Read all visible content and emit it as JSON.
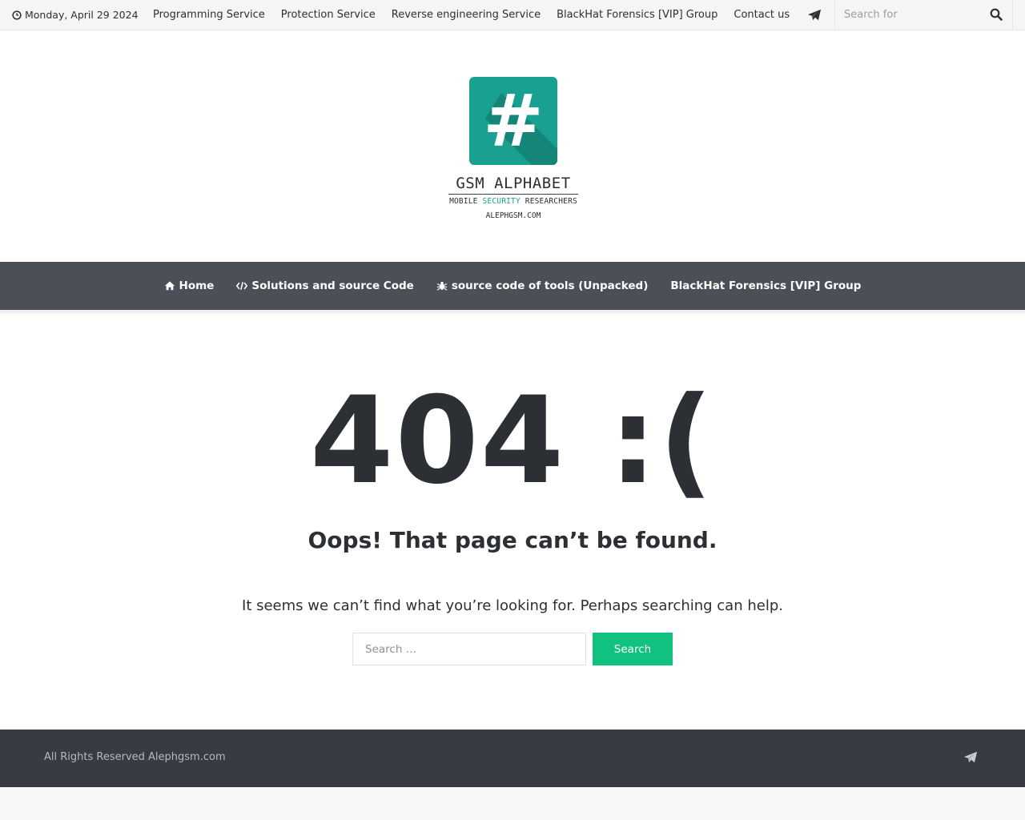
{
  "topbar": {
    "date": "Monday, April 29 2024",
    "nav": [
      {
        "label": "Programming Service"
      },
      {
        "label": "Protection Service"
      },
      {
        "label": "Reverse engineering Service"
      },
      {
        "label": "BlackHat Forensics [VIP] Group"
      },
      {
        "label": "Contact us"
      }
    ],
    "search_placeholder": "Search for",
    "icons": {
      "clock": "clock-icon",
      "telegram": "telegram-icon",
      "search": "search-icon"
    }
  },
  "logo": {
    "symbol": "#",
    "brand": "GSM ALPHABET",
    "tagline_pre": "MOBILE ",
    "tagline_highlight": "SECURITY",
    "tagline_post": " RESEARCHERS",
    "site": "ALEPHGSM.COM",
    "colors": {
      "tile": "#1aa090"
    }
  },
  "mainnav": {
    "items": [
      {
        "label": "Home",
        "icon": "home-icon"
      },
      {
        "label": "Solutions and source Code",
        "icon": "code-icon"
      },
      {
        "label": "source code of tools (Unpacked)",
        "icon": "bug-icon"
      },
      {
        "label": "BlackHat Forensics [VIP] Group",
        "icon": ""
      }
    ],
    "background": "#4b4f57"
  },
  "content": {
    "error_code": "404 :(",
    "title": "Oops! That page can’t be found.",
    "description": "It seems we can’t find what you’re looking for. Perhaps searching can help.",
    "search_placeholder": "Search …",
    "search_button": "Search",
    "button_color": "#10c17f"
  },
  "footer": {
    "copyright": "All Rights Reserved Alephgsm.com",
    "icon": "telegram-icon",
    "background": "#383b42"
  }
}
